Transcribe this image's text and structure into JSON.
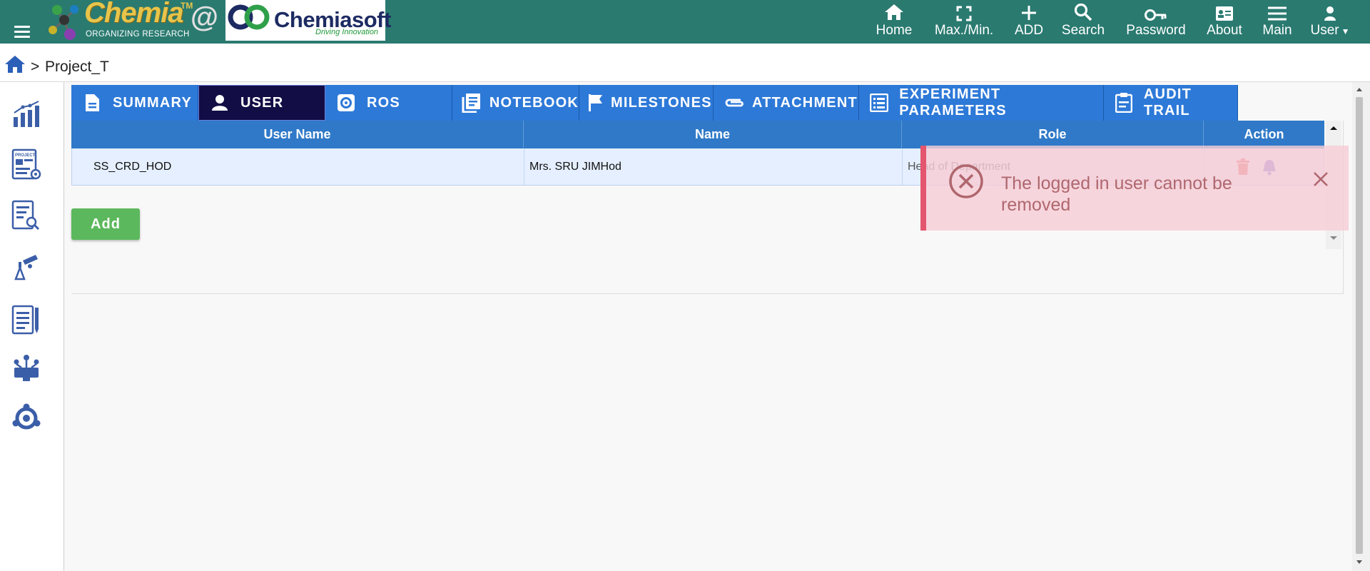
{
  "brand": {
    "name": "Chemia",
    "trademark": "TM",
    "tagline": "ORGANIZING RESEARCH",
    "at": "@",
    "partner_name": "Chemiasoft",
    "partner_tagline": "Driving Innovation"
  },
  "topnav": [
    {
      "label": "Home",
      "icon": "home-icon"
    },
    {
      "label": "Max./Min.",
      "icon": "fullscreen-icon"
    },
    {
      "label": "ADD",
      "icon": "plus-icon"
    },
    {
      "label": "Search",
      "icon": "search-icon"
    },
    {
      "label": "Password",
      "icon": "key-icon"
    },
    {
      "label": "About",
      "icon": "id-card-icon"
    },
    {
      "label": "Main",
      "icon": "menu-icon"
    },
    {
      "label": "User",
      "icon": "user-icon"
    }
  ],
  "breadcrumb": {
    "separator": ">",
    "current": "Project_T"
  },
  "tabs": [
    {
      "label": "SUMMARY",
      "icon": "document-icon"
    },
    {
      "label": "USER",
      "icon": "user-icon",
      "active": true
    },
    {
      "label": "ROS",
      "icon": "gear-icon"
    },
    {
      "label": "NOTEBOOK",
      "icon": "notebook-icon"
    },
    {
      "label": "MILESTONES",
      "icon": "flag-icon"
    },
    {
      "label": "ATTACHMENT",
      "icon": "paperclip-icon"
    },
    {
      "label": "EXPERIMENT PARAMETERS",
      "icon": "list-icon"
    },
    {
      "label": "AUDIT TRAIL",
      "icon": "audit-icon"
    }
  ],
  "grid": {
    "columns": [
      "User Name",
      "Name",
      "Role",
      "Action"
    ],
    "rows": [
      {
        "user_name": "SS_CRD_HOD",
        "name": "Mrs. SRU JIMHod",
        "role": "Head of Department"
      }
    ]
  },
  "add_button": "Add",
  "toast": {
    "message": "The logged in user cannot be removed",
    "type": "error"
  },
  "colors": {
    "topbar": "#2a7a70",
    "tab": "#2d79d8",
    "tab_active": "#120d45",
    "grid_header": "#2f79c8",
    "add_button": "#5cb85c",
    "toast_border": "#e3566e"
  }
}
